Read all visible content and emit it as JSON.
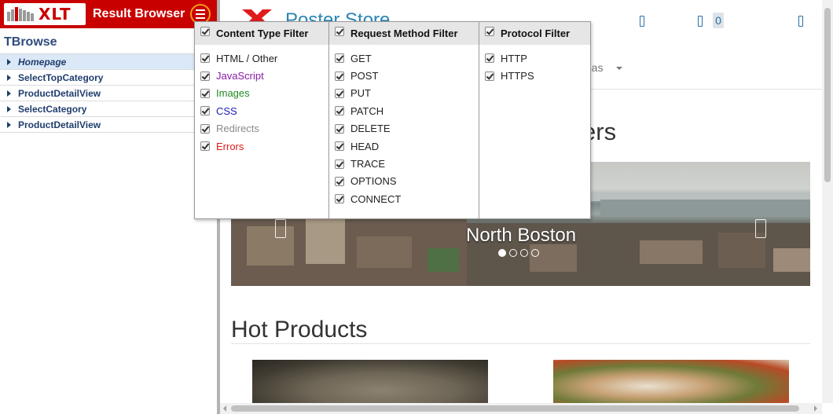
{
  "app": {
    "logo_text": "XLT",
    "title": "Result Browser",
    "tree_title": "TBrowse"
  },
  "tree": [
    {
      "label": "Homepage",
      "selected": true
    },
    {
      "label": "SelectTopCategory",
      "selected": false
    },
    {
      "label": "ProductDetailView",
      "selected": false
    },
    {
      "label": "SelectCategory",
      "selected": false
    },
    {
      "label": "ProductDetailView",
      "selected": false
    }
  ],
  "filters": {
    "content_type": {
      "title": "Content Type Filter",
      "items": [
        {
          "label": "HTML / Other",
          "color": "#222222",
          "checked": true
        },
        {
          "label": "JavaScript",
          "color": "#8b1aa8",
          "checked": true
        },
        {
          "label": "Images",
          "color": "#1f8a22",
          "checked": true
        },
        {
          "label": "CSS",
          "color": "#1a1ab5",
          "checked": true
        },
        {
          "label": "Redirects",
          "color": "#8a8a8a",
          "checked": true
        },
        {
          "label": "Errors",
          "color": "#e01b1b",
          "checked": true
        }
      ]
    },
    "request_method": {
      "title": "Request Method Filter",
      "items": [
        {
          "label": "GET",
          "checked": true
        },
        {
          "label": "POST",
          "checked": true
        },
        {
          "label": "PUT",
          "checked": true
        },
        {
          "label": "PATCH",
          "checked": true
        },
        {
          "label": "DELETE",
          "checked": true
        },
        {
          "label": "HEAD",
          "checked": true
        },
        {
          "label": "TRACE",
          "checked": true
        },
        {
          "label": "OPTIONS",
          "checked": true
        },
        {
          "label": "CONNECT",
          "checked": true
        }
      ]
    },
    "protocol": {
      "title": "Protocol Filter",
      "items": [
        {
          "label": "HTTP",
          "checked": true
        },
        {
          "label": "HTTPS",
          "checked": true
        }
      ]
    }
  },
  "page": {
    "store_name": "Poster Store",
    "cart_count": "0",
    "nav_partial": "mas",
    "heading_partial": "ers",
    "carousel_caption": "North Boston",
    "hot_products_title": "Hot Products"
  },
  "colors": {
    "header_red": "#c80000",
    "menu_ring": "#f39a1b",
    "tree_text": "#1f3d6d",
    "store_blue": "#2a85b7"
  }
}
